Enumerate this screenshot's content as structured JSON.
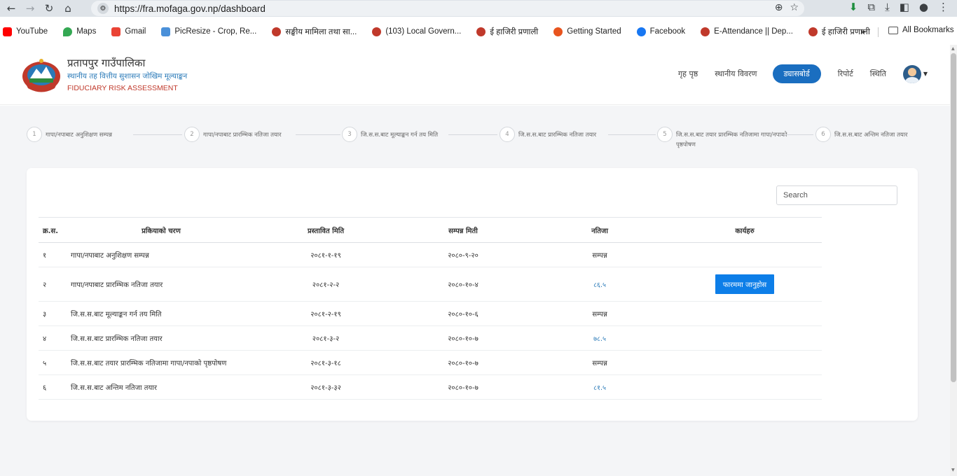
{
  "browser": {
    "url": "https://fra.mofaga.gov.np/dashboard",
    "bookmarks": [
      {
        "label": "YouTube",
        "color": "#ff0000"
      },
      {
        "label": "Maps",
        "color": "#34a853"
      },
      {
        "label": "Gmail",
        "color": "#ea4335"
      },
      {
        "label": "PicResize - Crop, Re...",
        "color": "#4a90d9"
      },
      {
        "label": "सङ्घीय मामिला तथा सा...",
        "color": "#c0392b"
      },
      {
        "label": "(103) Local Govern...",
        "color": "#c0392b"
      },
      {
        "label": "ई हाजिरी प्रणाली",
        "color": "#c0392b"
      },
      {
        "label": "Getting Started",
        "color": "#e8541e"
      },
      {
        "label": "Facebook",
        "color": "#1877f2"
      },
      {
        "label": "E-Attendance || Dep...",
        "color": "#c0392b"
      },
      {
        "label": "ई हाजिरी प्रणाली",
        "color": "#c0392b"
      }
    ],
    "more": "»",
    "all_bookmarks": "All Bookmarks"
  },
  "header": {
    "title": "प्रतापपुर गाउँपालिका",
    "subtitle": "स्थानीय तह वित्तीय सुशासन जोखिम मूल्याङ्कन",
    "english": "FIDUCIARY RISK ASSESSMENT",
    "nav": {
      "home": "गृह पृष्ठ",
      "local_details": "स्थानीय विवरण",
      "dashboard": "ड्यासबोर्ड",
      "report": "रिपोर्ट",
      "status": "स्थिति"
    }
  },
  "steps": [
    {
      "num": "1",
      "label": "गापा/नपाबाट अनुशिक्षण सम्पन्न"
    },
    {
      "num": "2",
      "label": "गापा/नपाबाट प्रारम्भिक नतिजा तयार"
    },
    {
      "num": "3",
      "label": "जि.स.स.बाट मूल्याङ्कन गर्न तय मिति"
    },
    {
      "num": "4",
      "label": "जि.स.स.बाट प्रारम्भिक नतिजा तयार"
    },
    {
      "num": "5",
      "label": "जि.स.स.बाट तयार प्रारम्भिक नतिजामा गापा/नपाको",
      "label2": "पृष्ठपोषण"
    },
    {
      "num": "6",
      "label": "जि.स.स.बाट अन्तिम नतिजा तयार"
    }
  ],
  "search": {
    "placeholder": "Search"
  },
  "table": {
    "headers": {
      "idx": "क्र.स.",
      "step": "प्रकियाको चरण",
      "proposed": "प्रस्तावित मिति",
      "completed": "सम्पन्न मिती",
      "result": "नतिजा",
      "actions": "कार्यहरु"
    },
    "rows": [
      {
        "idx": "१",
        "step": "गापा/नपाबाट अनुशिक्षण सम्पन्न",
        "proposed": "२०८१-१-१९",
        "completed": "२०८०-९-२०",
        "result": "सम्पन्न",
        "result_link": false,
        "action": ""
      },
      {
        "idx": "२",
        "step": "गापा/नपाबाट प्रारम्भिक नतिजा तयार",
        "proposed": "२०८१-२-२",
        "completed": "२०८०-१०-४",
        "result": "८६.५",
        "result_link": true,
        "action": "फारममा जानुहोस"
      },
      {
        "idx": "३",
        "step": "जि.स.स.बाट मूल्याङ्कन गर्न तय मिति",
        "proposed": "२०८१-२-१९",
        "completed": "२०८०-१०-६",
        "result": "सम्पन्न",
        "result_link": false,
        "action": ""
      },
      {
        "idx": "४",
        "step": "जि.स.स.बाट प्रारम्भिक नतिजा तयार",
        "proposed": "२०८१-३-२",
        "completed": "२०८०-१०-७",
        "result": "७८.५",
        "result_link": true,
        "action": ""
      },
      {
        "idx": "५",
        "step": "जि.स.स.बाट तयार प्रारम्भिक नतिजामा गापा/नपाको पृष्ठपोषण",
        "proposed": "२०८१-३-१८",
        "completed": "२०८०-१०-७",
        "result": "सम्पन्न",
        "result_link": false,
        "action": ""
      },
      {
        "idx": "६",
        "step": "जि.स.स.बाट अन्तिम नतिजा तयार",
        "proposed": "२०८१-३-३२",
        "completed": "२०८०-१०-७",
        "result": "८१.५",
        "result_link": true,
        "action": ""
      }
    ]
  }
}
